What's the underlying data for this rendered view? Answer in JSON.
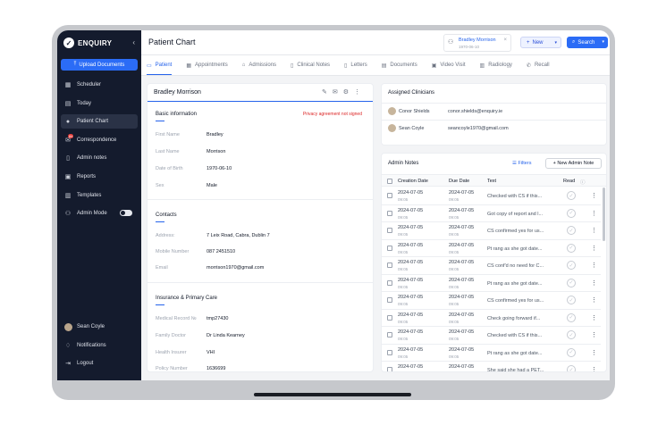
{
  "sidebar": {
    "brand": "ENQUIRY",
    "upload_label": "Upload Documents",
    "items": [
      {
        "label": "Scheduler"
      },
      {
        "label": "Today"
      },
      {
        "label": "Patient Chart"
      },
      {
        "label": "Correspondence",
        "badge": "84"
      },
      {
        "label": "Admin notes"
      },
      {
        "label": "Reports"
      },
      {
        "label": "Templates"
      },
      {
        "label": "Admin Mode"
      }
    ],
    "user": "Sean Coyle",
    "notifications": "Notifications",
    "logout": "Logout"
  },
  "header": {
    "title": "Patient Chart",
    "patient_name": "Bradley Morrison",
    "patient_date": "1970-06-10",
    "new_label": "New",
    "search_label": "Search"
  },
  "tabs": [
    "Patient",
    "Appointments",
    "Admissions",
    "Clinical Notes",
    "Letters",
    "Documents",
    "Video Visit",
    "Radiology",
    "Recall"
  ],
  "patient_card": {
    "name": "Bradley Morrison",
    "basic_title": "Basic information",
    "privacy": "Privacy agreement not signed",
    "basic": [
      {
        "label": "First Name",
        "value": "Bradley"
      },
      {
        "label": "Last Name",
        "value": "Morrison"
      },
      {
        "label": "Date of Birth",
        "value": "1970-06-10"
      },
      {
        "label": "Sex",
        "value": "Male"
      }
    ],
    "contacts_title": "Contacts",
    "contacts": [
      {
        "label": "Address:",
        "value": "7 Leix Road, Cabra, Dublin 7"
      },
      {
        "label": "Mobile Number",
        "value": "087 2451510"
      },
      {
        "label": "Email",
        "value": "morrison1970@gmail.com"
      }
    ],
    "insurance_title": "Insurance & Primary Care",
    "insurance": [
      {
        "label": "Medical Record №",
        "value": "tmp27430"
      },
      {
        "label": "Family Doctor",
        "value": "Dr Linda Kearney"
      },
      {
        "label": "Health Insurer",
        "value": "VHI"
      },
      {
        "label": "Policy Number",
        "value": "1636699"
      }
    ]
  },
  "clinicians": {
    "title": "Assigned Clinicians",
    "rows": [
      {
        "name": "Conor Shields",
        "email": "conor.shields@enquiry.ie"
      },
      {
        "name": "Sean Coyle",
        "email": "seancoyle1970@gmail.com"
      }
    ]
  },
  "notes": {
    "title": "Admin Notes",
    "filters_label": "Filters",
    "new_label": "New Admin Note",
    "columns": [
      "Creation Date",
      "Due Date",
      "Text",
      "Read"
    ],
    "rows": [
      {
        "created": "2024-07-05",
        "created_time": "09:05",
        "due": "2024-07-05",
        "due_time": "09:05",
        "text": "Checked with CS if this..."
      },
      {
        "created": "2024-07-05",
        "created_time": "09:05",
        "due": "2024-07-05",
        "due_time": "09:05",
        "text": "Got copy of report and l..."
      },
      {
        "created": "2024-07-05",
        "created_time": "09:05",
        "due": "2024-07-05",
        "due_time": "09:05",
        "text": "CS confirmed yes for us..."
      },
      {
        "created": "2024-07-05",
        "created_time": "09:05",
        "due": "2024-07-05",
        "due_time": "09:05",
        "text": "Pt rang as she got date..."
      },
      {
        "created": "2024-07-05",
        "created_time": "09:05",
        "due": "2024-07-05",
        "due_time": "09:05",
        "text": "CS conf'd no need for C..."
      },
      {
        "created": "2024-07-05",
        "created_time": "09:05",
        "due": "2024-07-05",
        "due_time": "09:05",
        "text": "Pt rang as she got date..."
      },
      {
        "created": "2024-07-05",
        "created_time": "09:05",
        "due": "2024-07-05",
        "due_time": "09:05",
        "text": "CS confirmed yes for us..."
      },
      {
        "created": "2024-07-05",
        "created_time": "09:05",
        "due": "2024-07-05",
        "due_time": "09:05",
        "text": "Check going forward if..."
      },
      {
        "created": "2024-07-05",
        "created_time": "09:05",
        "due": "2024-07-05",
        "due_time": "09:05",
        "text": "Checked with CS if this..."
      },
      {
        "created": "2024-07-05",
        "created_time": "09:05",
        "due": "2024-07-05",
        "due_time": "09:05",
        "text": "Pt rang as she got date..."
      },
      {
        "created": "2024-07-05",
        "created_time": "09:05",
        "due": "2024-07-05",
        "due_time": "09:05",
        "text": "She said she had a PET..."
      }
    ]
  },
  "colors": {
    "accent": "#2563eb",
    "sidebar": "#141b2d",
    "alert": "#dc2626"
  }
}
